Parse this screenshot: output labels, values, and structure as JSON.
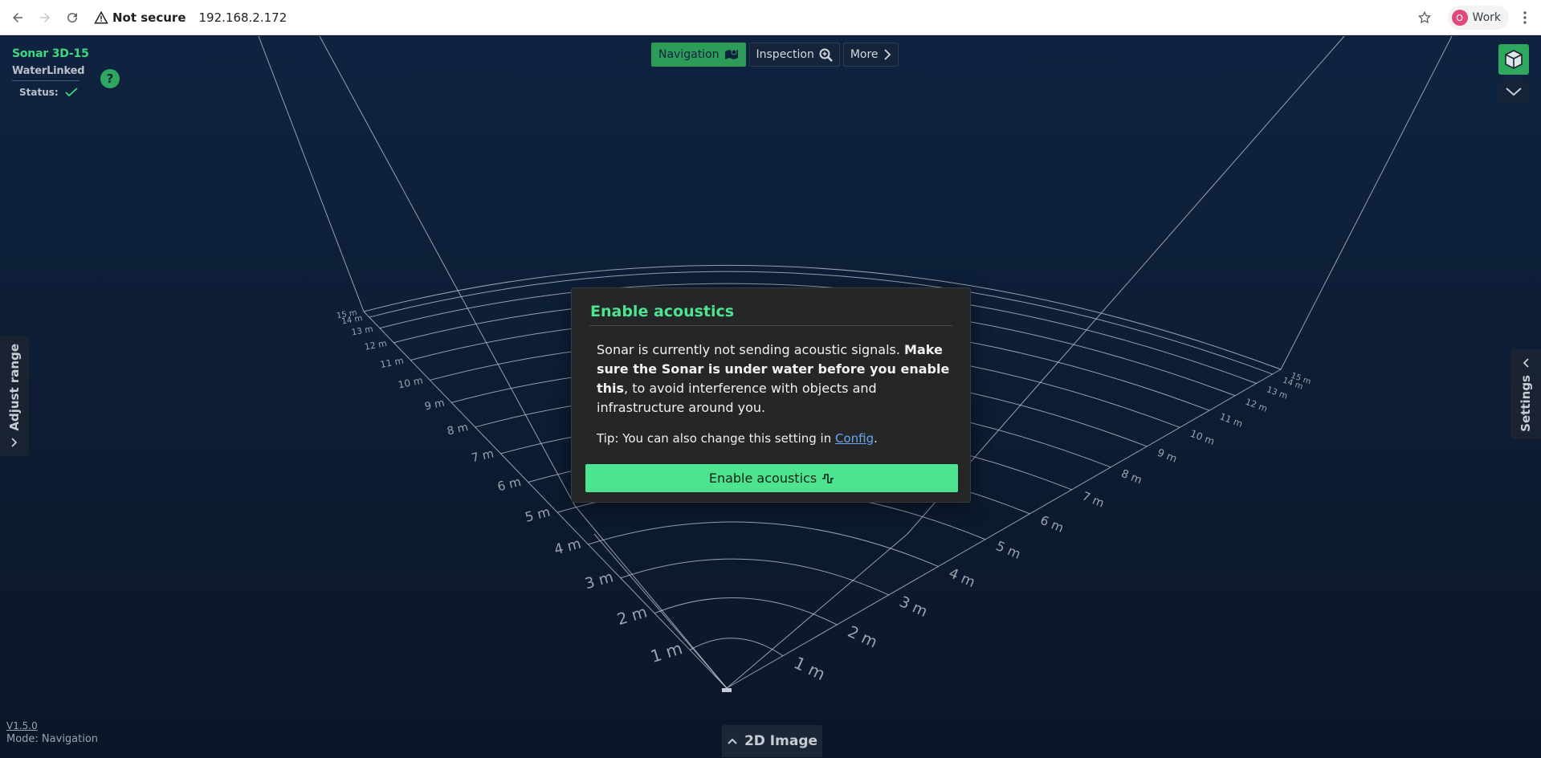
{
  "browser": {
    "security_label": "Not secure",
    "url": "192.168.2.172",
    "profile_initial": "O",
    "profile_name": "Work"
  },
  "app": {
    "product_name": "Sonar 3D-15",
    "logo_text": "WaterLinked",
    "status_label": "Status:",
    "help_label": "?",
    "modes": [
      {
        "label": "Navigation",
        "icon": "map-icon",
        "active": true
      },
      {
        "label": "Inspection",
        "icon": "magnify-icon",
        "active": false
      },
      {
        "label": "More",
        "icon": "chevron-right-icon",
        "active": false
      }
    ],
    "adjust_range_label": "Adjust range",
    "settings_label": "Settings",
    "version": "V1.5.0",
    "mode_text": "Mode: Navigation",
    "image_2d_label": "2D Image"
  },
  "modal": {
    "title": "Enable acoustics",
    "body_part1": "Sonar is currently not sending acoustic signals. ",
    "body_bold": "Make sure the Sonar is under water before you enable this",
    "body_part2": ", to avoid interference with objects and infrastructure around you.",
    "tip_prefix": "Tip: You can also change this setting in ",
    "tip_link": "Config",
    "tip_suffix": ".",
    "button_label": "Enable acoustics"
  },
  "range_labels": {
    "left": [
      "15 m",
      "14 m",
      "13 m",
      "12 m",
      "11 m",
      "10 m",
      "9 m",
      "8 m",
      "7 m",
      "6 m",
      "5 m",
      "4 m",
      "3 m",
      "2 m",
      "1 m"
    ],
    "right": [
      "15 m",
      "14 m",
      "13 m",
      "12 m",
      "11 m",
      "10 m",
      "9 m",
      "8 m",
      "7 m",
      "6 m",
      "5 m",
      "4 m",
      "3 m",
      "2 m",
      "1 m"
    ]
  },
  "colors": {
    "accent": "#4ee38f",
    "brand_green": "#3ed97f",
    "background": "#0f2340"
  }
}
